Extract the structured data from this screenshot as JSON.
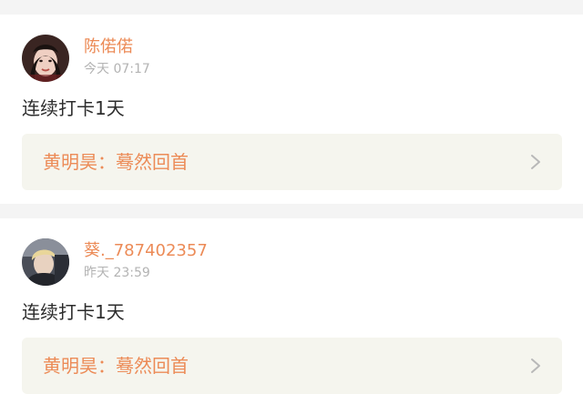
{
  "posts": [
    {
      "username": "陈偌偌",
      "time": "今天 07:17",
      "content": "连续打卡1天",
      "task": "黄明昊：蓦然回首"
    },
    {
      "username": "葵._787402357",
      "time": "昨天 23:59",
      "content": "连续打卡1天",
      "task": "黄明昊：蓦然回首"
    }
  ],
  "colors": {
    "accent": "#ec8b57",
    "muted": "#b3b3b3",
    "text": "#2c2c2c",
    "task_bg": "#f5f5ee",
    "page_bg": "#f4f4f4"
  }
}
